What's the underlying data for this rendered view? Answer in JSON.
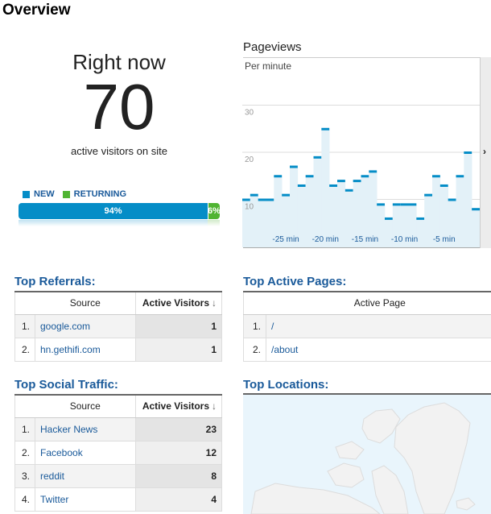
{
  "page": {
    "title": "Overview"
  },
  "right_now": {
    "label": "Right now",
    "count": "70",
    "subtitle": "active visitors on site",
    "legend": [
      {
        "label": "NEW",
        "color": "#058dc7"
      },
      {
        "label": "RETURNING",
        "color": "#50b432"
      }
    ],
    "split": [
      {
        "name": "new",
        "percent": 94,
        "label": "94%",
        "color": "#058dc7"
      },
      {
        "name": "returning",
        "percent": 6,
        "label": "6%",
        "color": "#50b432"
      }
    ]
  },
  "pageviews": {
    "title": "Pageviews",
    "subtitle": "Per minute",
    "next_icon": "chevron-right-icon",
    "next_glyph": "›"
  },
  "chart_data": {
    "type": "bar",
    "title": "Pageviews",
    "subtitle": "Per minute",
    "xlabel": "",
    "ylabel": "",
    "x": [
      -30,
      -29,
      -28,
      -27,
      -26,
      -25,
      -24,
      -23,
      -22,
      -21,
      -20,
      -19,
      -18,
      -17,
      -16,
      -15,
      -14,
      -13,
      -12,
      -11,
      -10,
      -9,
      -8,
      -7,
      -6,
      -5,
      -4,
      -3,
      -2,
      -1
    ],
    "values": [
      10,
      11,
      10,
      10,
      15,
      11,
      17,
      13,
      15,
      19,
      25,
      13,
      14,
      12,
      14,
      15,
      16,
      9,
      6,
      9,
      9,
      9,
      6,
      11,
      15,
      13,
      10,
      15,
      20,
      8
    ],
    "yticks": [
      10,
      20,
      30
    ],
    "xticks": [
      {
        "at": -25,
        "label": "-25 min"
      },
      {
        "at": -20,
        "label": "-20 min"
      },
      {
        "at": -15,
        "label": "-15 min"
      },
      {
        "at": -10,
        "label": "-10 min"
      },
      {
        "at": -5,
        "label": "-5 min"
      }
    ],
    "ylim": [
      0,
      38
    ],
    "grid": true,
    "bar_color": "#058dc7",
    "fill_color": "#e3f1f8"
  },
  "referrals": {
    "title": "Top Referrals:",
    "columns": [
      "Source",
      "Active Visitors"
    ],
    "sort_icon": "↓",
    "rows": [
      {
        "index": "1.",
        "source": "google.com",
        "visitors": "1"
      },
      {
        "index": "2.",
        "source": "hn.gethifi.com",
        "visitors": "1"
      }
    ]
  },
  "active_pages": {
    "title": "Top Active Pages:",
    "columns": [
      "Active Page"
    ],
    "rows": [
      {
        "index": "1.",
        "page": "/"
      },
      {
        "index": "2.",
        "page": "/about"
      }
    ]
  },
  "social": {
    "title": "Top Social Traffic:",
    "columns": [
      "Source",
      "Active Visitors"
    ],
    "sort_icon": "↓",
    "rows": [
      {
        "index": "1.",
        "source": "Hacker News",
        "visitors": "23"
      },
      {
        "index": "2.",
        "source": "Facebook",
        "visitors": "12"
      },
      {
        "index": "3.",
        "source": "reddit",
        "visitors": "8"
      },
      {
        "index": "4.",
        "source": "Twitter",
        "visitors": "4"
      }
    ]
  },
  "locations": {
    "title": "Top Locations:"
  }
}
